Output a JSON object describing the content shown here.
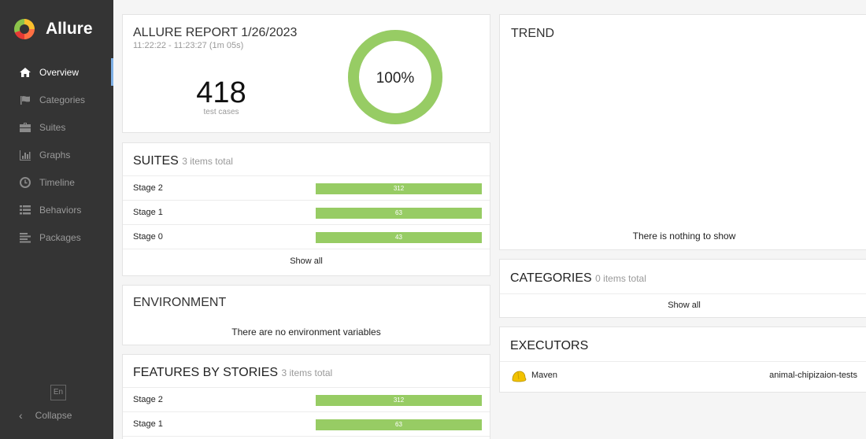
{
  "brand": {
    "name": "Allure"
  },
  "sidebar": {
    "items": [
      {
        "label": "Overview",
        "icon": "home-icon",
        "active": true
      },
      {
        "label": "Categories",
        "icon": "flag-icon"
      },
      {
        "label": "Suites",
        "icon": "briefcase-icon"
      },
      {
        "label": "Graphs",
        "icon": "bar-chart-icon"
      },
      {
        "label": "Timeline",
        "icon": "clock-icon"
      },
      {
        "label": "Behaviors",
        "icon": "list-icon"
      },
      {
        "label": "Packages",
        "icon": "align-left-icon"
      }
    ],
    "language": "En",
    "collapse_label": "Collapse"
  },
  "summary": {
    "title": "ALLURE REPORT 1/26/2023",
    "time_range": "11:22:22 - 11:23:27 (1m 05s)",
    "test_count": "418",
    "test_count_label": "test cases",
    "pass_rate": "100%",
    "pass_fraction": 1.0,
    "pass_color": "#97cc64"
  },
  "suites": {
    "title": "SUITES",
    "total": "3 items total",
    "rows": [
      {
        "name": "Stage 2",
        "count": "312"
      },
      {
        "name": "Stage 1",
        "count": "63"
      },
      {
        "name": "Stage 0",
        "count": "43"
      }
    ],
    "show_all": "Show all"
  },
  "environment": {
    "title": "ENVIRONMENT",
    "empty_message": "There are no environment variables"
  },
  "features": {
    "title": "FEATURES BY STORIES",
    "total": "3 items total",
    "rows": [
      {
        "name": "Stage 2",
        "count": "312"
      },
      {
        "name": "Stage 1",
        "count": "63"
      }
    ]
  },
  "trend": {
    "title": "TREND",
    "empty_message": "There is nothing to show"
  },
  "categories": {
    "title": "CATEGORIES",
    "total": "0 items total",
    "show_all": "Show all"
  },
  "executors": {
    "title": "EXECUTORS",
    "rows": [
      {
        "name": "Maven",
        "build": "animal-chipizaion-tests",
        "icon": "maven-hardhat-icon"
      }
    ]
  }
}
